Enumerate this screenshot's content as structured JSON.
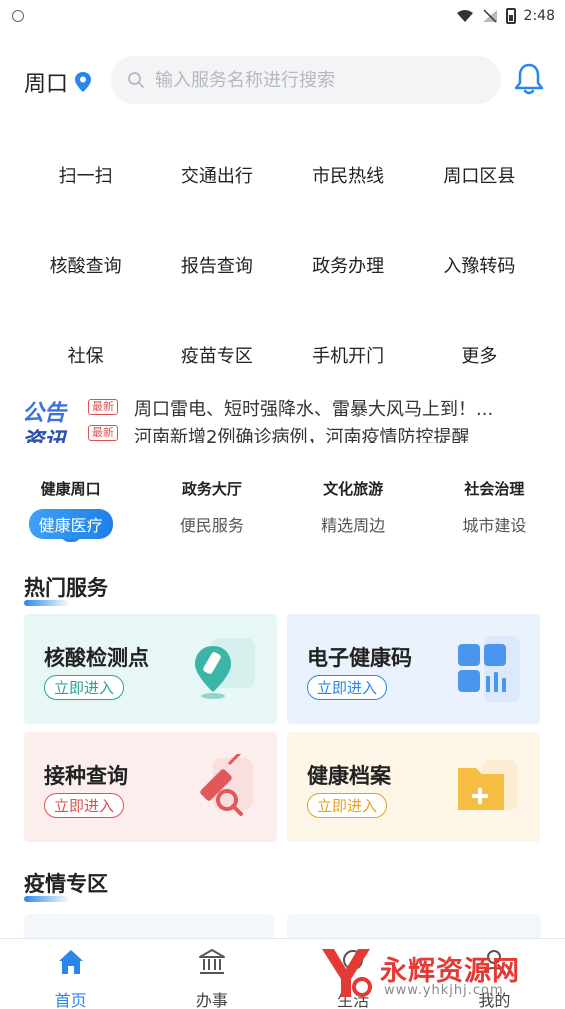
{
  "status_bar": {
    "time": "2:48"
  },
  "header": {
    "city": "周口",
    "search_placeholder": "输入服务名称进行搜索"
  },
  "quick_grid": [
    [
      "扫一扫",
      "交通出行",
      "市民热线",
      "周口区县"
    ],
    [
      "核酸查询",
      "报告查询",
      "政务办理",
      "入豫转码"
    ],
    [
      "社保",
      "疫苗专区",
      "手机开门",
      "更多"
    ]
  ],
  "notice": {
    "logo_top": "公告",
    "logo_bottom": "资讯",
    "tag": "最新",
    "items": [
      "周口雷电、短时强降水、雷暴大风马上到！...",
      "河南新增2例确诊病例，河南疫情防控提醒"
    ]
  },
  "categories": [
    {
      "title": "健康周口",
      "sub": "健康医疗",
      "active": true
    },
    {
      "title": "政务大厅",
      "sub": "便民服务",
      "active": false
    },
    {
      "title": "文化旅游",
      "sub": "精选周边",
      "active": false
    },
    {
      "title": "社会治理",
      "sub": "城市建设",
      "active": false
    }
  ],
  "hot_services": {
    "title": "热门服务",
    "cards": [
      {
        "name": "核酸检测点",
        "enter": "立即进入",
        "icon": "test-tube-location-icon",
        "color": "#26a69a"
      },
      {
        "name": "电子健康码",
        "enter": "立即进入",
        "icon": "qr-grid-icon",
        "color": "#2b86ec"
      },
      {
        "name": "接种查询",
        "enter": "立即进入",
        "icon": "syringe-search-icon",
        "color": "#e05050"
      },
      {
        "name": "健康档案",
        "enter": "立即进入",
        "icon": "folder-plus-icon",
        "color": "#e9a020"
      }
    ]
  },
  "epidemic": {
    "title": "疫情专区"
  },
  "tabbar": [
    {
      "label": "首页",
      "icon": "home-icon",
      "active": true
    },
    {
      "label": "办事",
      "icon": "bank-icon",
      "active": false
    },
    {
      "label": "生活",
      "icon": "life-icon",
      "active": false
    },
    {
      "label": "我的",
      "icon": "user-icon",
      "active": false
    }
  ],
  "watermark": {
    "brand": "永辉资源网",
    "url": "www.yhkjhj.com"
  },
  "colors": {
    "accent": "#2b86ec",
    "accent_light": "#3fa1f6"
  }
}
